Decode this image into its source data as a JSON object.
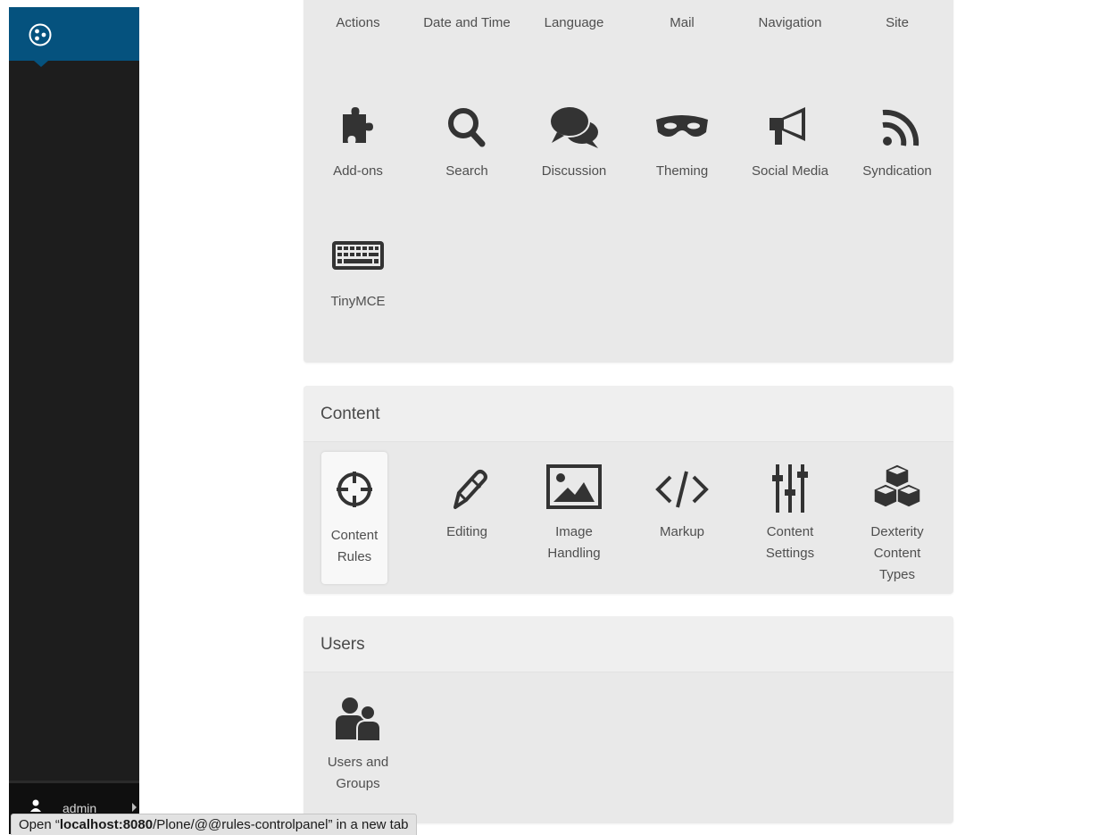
{
  "sidebar": {
    "user_name": "admin"
  },
  "general_panel": {
    "tiles": [
      {
        "label": "Actions",
        "icon": "actions-gears-icon"
      },
      {
        "label": "Date and Time",
        "icon": "calendar-icon"
      },
      {
        "label": "Language",
        "icon": "language-icon"
      },
      {
        "label": "Mail",
        "icon": "mail-icon"
      },
      {
        "label": "Navigation",
        "icon": "navigation-icon"
      },
      {
        "label": "Site",
        "icon": "site-icon"
      },
      {
        "label": "Add-ons",
        "icon": "puzzle-icon"
      },
      {
        "label": "Search",
        "icon": "search-icon"
      },
      {
        "label": "Discussion",
        "icon": "comments-icon"
      },
      {
        "label": "Theming",
        "icon": "mask-icon"
      },
      {
        "label": "Social Media",
        "icon": "megaphone-icon"
      },
      {
        "label": "Syndication",
        "icon": "rss-icon"
      },
      {
        "label": "TinyMCE",
        "icon": "keyboard-icon"
      }
    ]
  },
  "content_panel": {
    "title": "Content",
    "tiles": [
      {
        "label": "Content Rules",
        "icon": "crosshair-icon"
      },
      {
        "label": "Editing",
        "icon": "pencil-icon"
      },
      {
        "label": "Image Handling",
        "icon": "image-icon"
      },
      {
        "label": "Markup",
        "icon": "code-icon"
      },
      {
        "label": "Content Settings",
        "icon": "sliders-icon"
      },
      {
        "label": "Dexterity Content Types",
        "icon": "cubes-icon"
      }
    ]
  },
  "users_panel": {
    "title": "Users",
    "tiles": [
      {
        "label": "Users and Groups",
        "icon": "users-icon"
      }
    ]
  },
  "status_bar": {
    "prefix": "Open “",
    "host": "localhost:8080",
    "path": "/Plone/@@rules-controlpanel",
    "suffix": "” in a new tab"
  },
  "colors": {
    "sidebar_bg": "#1d1d1d",
    "logo_bg": "#05527e",
    "panel_bg": "#e9e9e9",
    "icon_color": "#333333"
  }
}
